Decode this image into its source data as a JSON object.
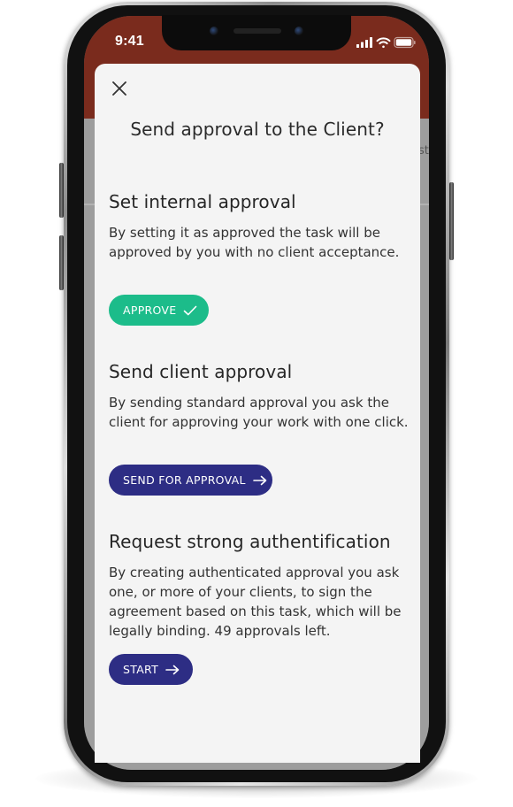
{
  "status_bar": {
    "time": "9:41"
  },
  "background": {
    "peek_text": "st"
  },
  "dialog": {
    "title": "Send approval to the Client?",
    "close_icon": "close-icon"
  },
  "sections": [
    {
      "heading": "Set internal approval",
      "body": "By setting it as approved the task will be approved by you with no client acceptance.",
      "button_label": "APPROVE",
      "button_icon": "check-icon",
      "button_color": "#1cbc8a"
    },
    {
      "heading": "Send client approval",
      "body": "By sending standard approval you ask the client for approving your work with one click.",
      "button_label": "SEND FOR APPROVAL",
      "button_icon": "arrow-right-icon",
      "button_color": "#2d2d84"
    },
    {
      "heading": "Request strong authentification",
      "body": "By creating authenticated approval you ask one, or more of your clients, to sign the agreement based on this task, which will be legally binding. 49 approvals left.",
      "button_label": "START",
      "button_icon": "arrow-right-icon",
      "button_color": "#2d2d84"
    }
  ],
  "colors": {
    "header": "#7a2b1d",
    "sheet": "#f4f4f4",
    "accent_green": "#1cbc8a",
    "accent_navy": "#2d2d84"
  }
}
